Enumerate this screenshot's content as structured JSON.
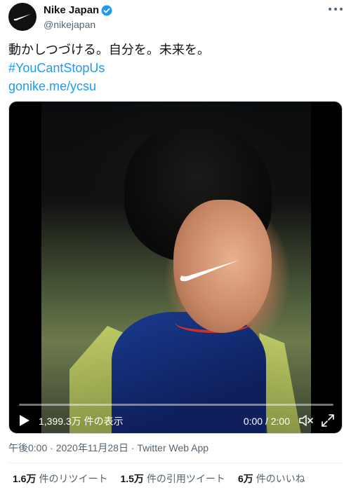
{
  "account": {
    "display_name": "Nike Japan",
    "handle": "@nikejapan",
    "avatar_icon": "nike-swoosh-logo",
    "verified": true,
    "verified_color": "#1d9bf0"
  },
  "tweet": {
    "text_line1": "動かしつづける。自分を。未来を。",
    "hashtag": "#YouCantStopUs",
    "link": "gonike.me/ycsu",
    "link_color": "#1d9bf0"
  },
  "video": {
    "views": "1,399.3万 件の表示",
    "time": "0:00 / 2:00",
    "progress": 0,
    "overlay_logo": "nike-swoosh",
    "play_icon": "play-icon",
    "mute_icon": "muted-speaker-icon",
    "fullscreen_icon": "fullscreen-icon"
  },
  "meta": {
    "timestamp_source": "午後0:00 · 2020年11月28日 · Twitter Web App"
  },
  "stats": {
    "retweets_count": "1.6万",
    "retweets_label": "件のリツイート",
    "quotes_count": "1.5万",
    "quotes_label": "件の引用ツイート",
    "likes_count": "6万",
    "likes_label": "件のいいね"
  }
}
